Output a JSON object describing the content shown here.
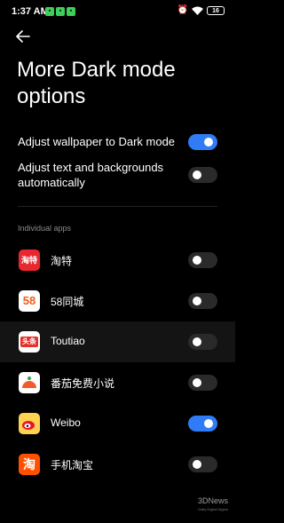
{
  "status_bar": {
    "time": "1:37 AM",
    "battery": "16"
  },
  "page": {
    "title": "More Dark mode options"
  },
  "settings": [
    {
      "label": "Adjust wallpaper to Dark mode",
      "on": true
    },
    {
      "label": "Adjust text and backgrounds automatically",
      "on": false
    }
  ],
  "section_label": "Individual apps",
  "apps": [
    {
      "name": "淘特",
      "icon_text": "淘特",
      "on": false
    },
    {
      "name": "58同城",
      "icon_text": "58",
      "on": false
    },
    {
      "name": "Toutiao",
      "icon_text": "头条",
      "on": false
    },
    {
      "name": "番茄免费小说",
      "icon_text": "",
      "on": false
    },
    {
      "name": "Weibo",
      "icon_text": "",
      "on": true
    },
    {
      "name": "手机淘宝",
      "icon_text": "淘",
      "on": false
    }
  ],
  "watermark": {
    "text": "3DNews",
    "subtext": "Daily Digital Digest"
  },
  "colors": {
    "accent": "#2f7cf6",
    "background": "#000000",
    "toggle_off": "#2a2a2a"
  }
}
